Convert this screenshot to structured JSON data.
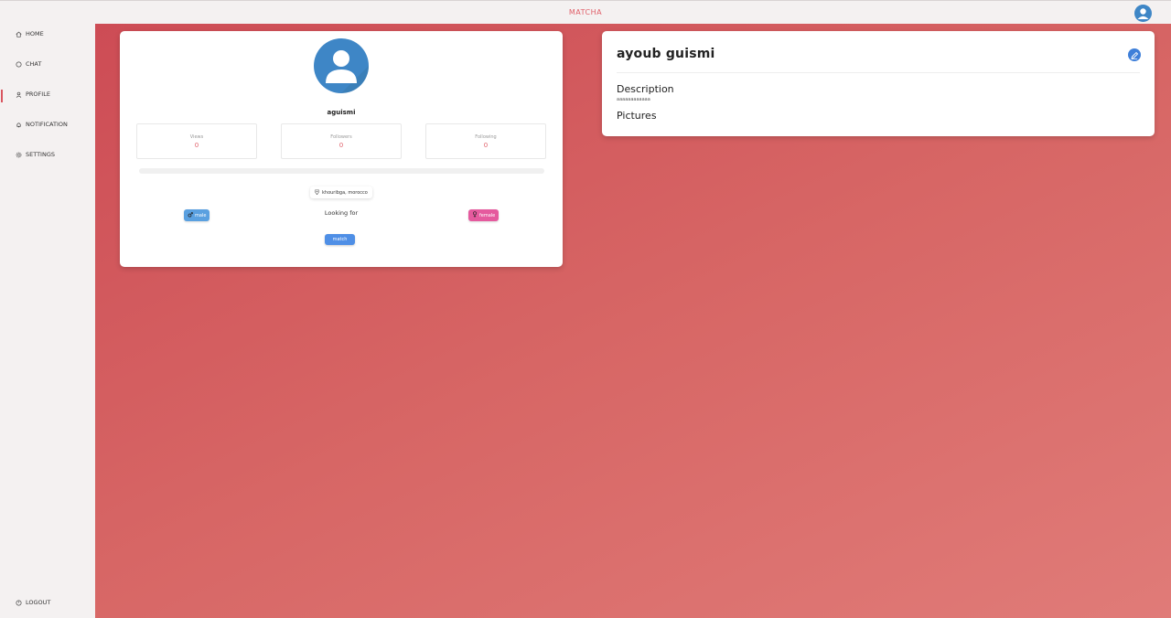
{
  "app": {
    "brand": "MATCHA"
  },
  "sidebar": {
    "items": [
      {
        "label": "HOME",
        "icon": "home-icon"
      },
      {
        "label": "CHAT",
        "icon": "chat-icon"
      },
      {
        "label": "PROFILE",
        "icon": "user-icon",
        "active": true
      },
      {
        "label": "NOTIFICATION",
        "icon": "bell-icon"
      },
      {
        "label": "SETTINGS",
        "icon": "gear-icon"
      }
    ],
    "logout": "LOGOUT"
  },
  "profile": {
    "username": "aguismi",
    "stats": [
      {
        "label": "Views",
        "value": "0"
      },
      {
        "label": "Followers",
        "value": "0"
      },
      {
        "label": "Following",
        "value": "0"
      }
    ],
    "progress": 0,
    "location": "khouribga, morocco",
    "gender": "male",
    "looking_for_label": "Looking for",
    "interest": "female",
    "match_label": "match"
  },
  "details": {
    "full_name": "ayoub guismi",
    "description_title": "Description",
    "description_text": "aaaaaaaaaaaa",
    "pictures_title": "Pictures"
  },
  "colors": {
    "accent": "#e0606a",
    "avatar": "#3e86c6",
    "male": "#5aa0e0",
    "female": "#e55a9e",
    "button": "#4f8fe6"
  }
}
